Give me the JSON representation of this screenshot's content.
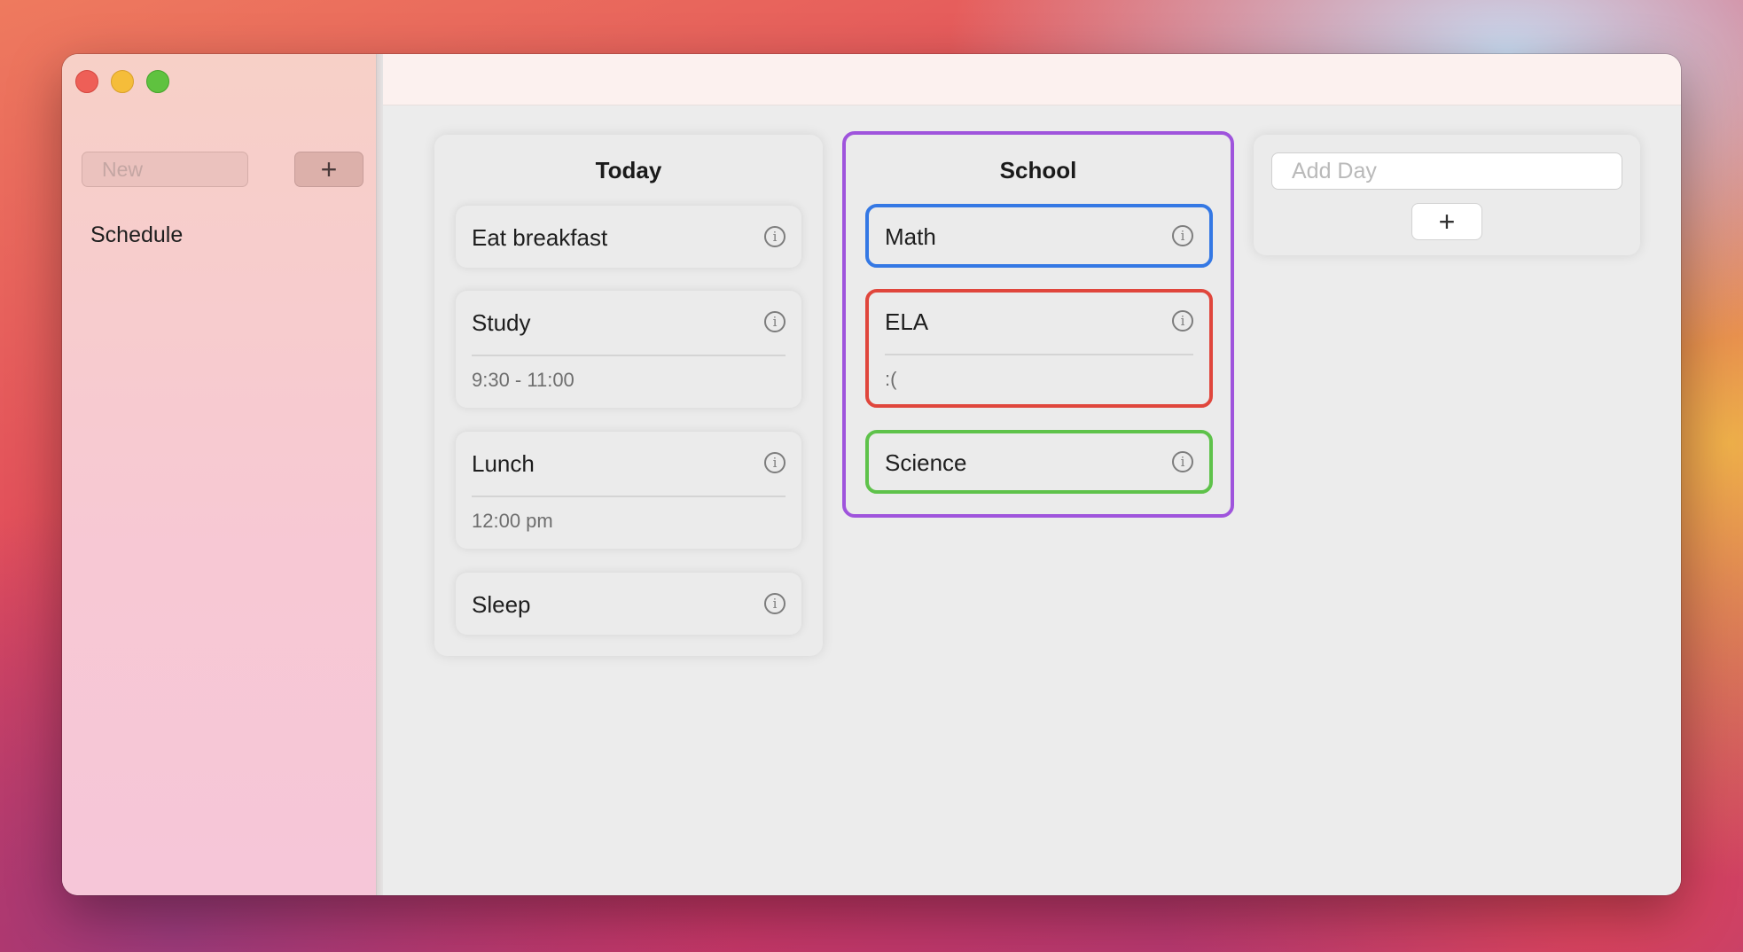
{
  "window_controls": [
    "close",
    "minimize",
    "zoom"
  ],
  "sidebar": {
    "new_placeholder": "New",
    "add_label": "+",
    "items": [
      {
        "label": "Schedule"
      }
    ]
  },
  "columns": [
    {
      "title": "Today",
      "cards": [
        {
          "title": "Eat breakfast",
          "detail": ""
        },
        {
          "title": "Study",
          "detail": "9:30 - 11:00"
        },
        {
          "title": "Lunch",
          "detail": "12:00 pm"
        },
        {
          "title": "Sleep",
          "detail": ""
        }
      ]
    },
    {
      "title": "School",
      "border_color": "#9f54dc",
      "cards": [
        {
          "title": "Math",
          "detail": "",
          "border_color": "#3478e4"
        },
        {
          "title": "ELA",
          "detail": ":(",
          "border_color": "#e0463c"
        },
        {
          "title": "Science",
          "detail": "",
          "border_color": "#5ec24a"
        }
      ]
    }
  ],
  "add_day": {
    "placeholder": "Add Day",
    "add_label": "+"
  },
  "info_icon_glyph": "i"
}
